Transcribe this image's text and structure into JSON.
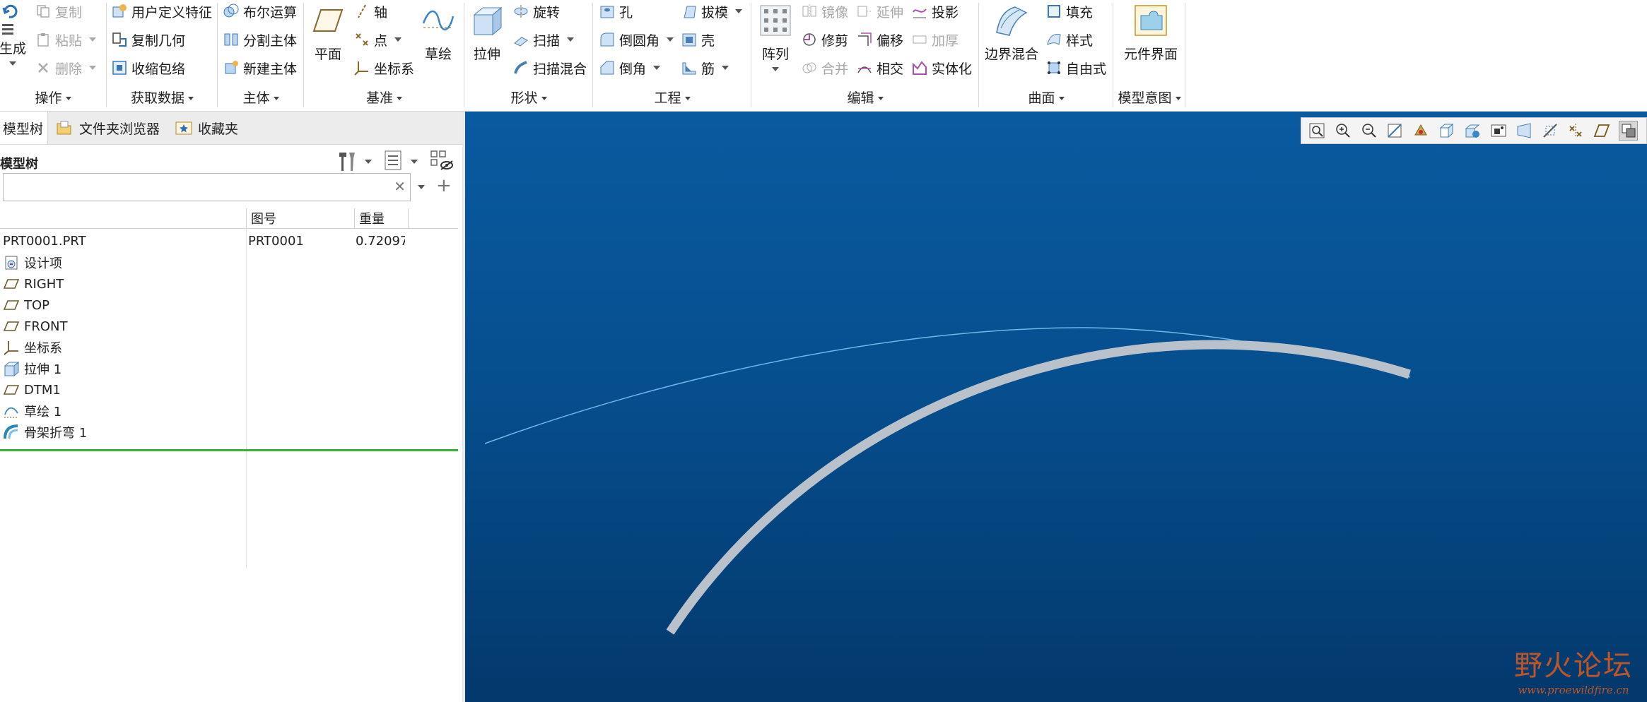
{
  "ribbon": {
    "operations": {
      "name": "操作",
      "regenerate": "生成",
      "copy": "复制",
      "paste": "粘贴",
      "delete": "删除"
    },
    "get_data": {
      "name": "获取数据",
      "udf": "用户定义特征",
      "copy_geometry": "复制几何",
      "shrinkwrap": "收缩包络"
    },
    "body": {
      "name": "主体",
      "boolean": "布尔运算",
      "split_body": "分割主体",
      "new_body": "新建主体"
    },
    "datum": {
      "name": "基准",
      "plane": "平面",
      "axis": "轴",
      "point": "点",
      "csys": "坐标系",
      "sketch": "草绘"
    },
    "shapes": {
      "name": "形状",
      "extrude": "拉伸",
      "revolve": "旋转",
      "sweep": "扫描",
      "swept_blend": "扫描混合"
    },
    "engineering": {
      "name": "工程",
      "hole": "孔",
      "round": "倒圆角",
      "chamfer": "倒角",
      "draft": "拔模",
      "shell": "壳",
      "rib": "筋"
    },
    "editing": {
      "name": "编辑",
      "pattern": "阵列",
      "mirror": "镜像",
      "trim": "修剪",
      "merge": "合并",
      "extend": "延伸",
      "offset": "偏移",
      "intersect": "相交",
      "project": "投影",
      "thicken": "加厚",
      "solidify": "实体化"
    },
    "surfaces": {
      "name": "曲面",
      "boundary_blend": "边界混合",
      "fill": "填充",
      "style": "样式",
      "freestyle": "自由式"
    },
    "model_intent": {
      "name": "模型意图",
      "component_interface": "元件界面"
    }
  },
  "left_tabs": {
    "model_tree": "模型树",
    "folder_browser": "文件夹浏览器",
    "favorites": "收藏夹"
  },
  "tree": {
    "title": "模型树",
    "search_value": "",
    "columns": {
      "number": "图号",
      "weight": "重量"
    },
    "root": {
      "name": "PRT0001.PRT",
      "number": "PRT0001",
      "weight": "0.72097"
    },
    "items": [
      {
        "label": "设计项",
        "icon": "design-items-icon"
      },
      {
        "label": "RIGHT",
        "icon": "datum-plane-icon"
      },
      {
        "label": "TOP",
        "icon": "datum-plane-icon"
      },
      {
        "label": "FRONT",
        "icon": "datum-plane-icon"
      },
      {
        "label": "坐标系",
        "icon": "csys-icon"
      },
      {
        "label": "拉伸 1",
        "icon": "extrude-icon"
      },
      {
        "label": "DTM1",
        "icon": "datum-plane-icon"
      },
      {
        "label": "草绘 1",
        "icon": "sketch-icon"
      },
      {
        "label": "骨架折弯 1",
        "icon": "spinal-bend-icon"
      }
    ]
  },
  "watermark": {
    "cn": "野火论坛",
    "url": "www.proewildfire.cn"
  },
  "colors": {
    "viewport_top": "#0a5aa0",
    "viewport_bottom": "#03396c",
    "insert_line": "#33b533",
    "bar": "#b9c1cb",
    "curve": "#6fb6ea"
  }
}
